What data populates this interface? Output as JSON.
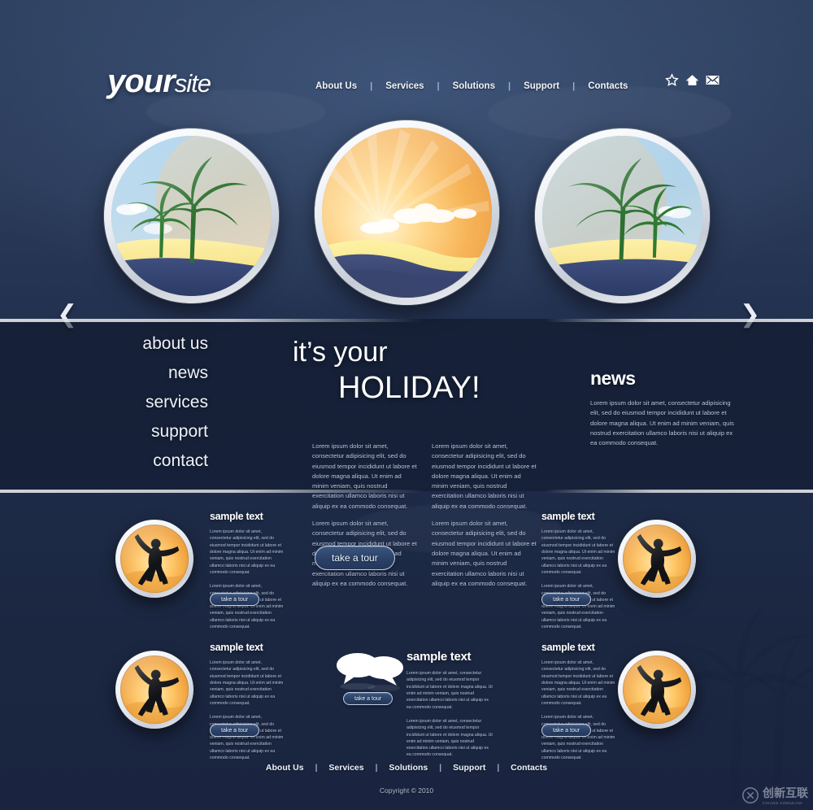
{
  "brand": {
    "part1": "your",
    "part2": "site"
  },
  "header": {
    "nav": [
      "About Us",
      "Services",
      "Solutions",
      "Support",
      "Contacts"
    ],
    "separator": "|",
    "icons": [
      "star-icon",
      "home-icon",
      "mail-icon"
    ]
  },
  "carousel": {
    "prev_label": "❮",
    "next_label": "❯",
    "slides": [
      {
        "name": "palm-beach-left",
        "caption": ""
      },
      {
        "name": "sunset-center",
        "caption": ""
      },
      {
        "name": "palm-beach-right",
        "caption": ""
      }
    ]
  },
  "sidemenu": {
    "items": [
      "about us",
      "news",
      "services",
      "support",
      "contact"
    ]
  },
  "hero": {
    "line1": "it’s your",
    "line2": "HOLIDAY!",
    "button": "take a tour",
    "columns": [
      {
        "paragraphs": [
          "Lorem ipsum dolor sit amet, consectetur adipisicing elit, sed do eiusmod tempor incididunt ut labore et dolore magna aliqua. Ut enim ad minim veniam, quis nostrud exercitation ullamco laboris nisi ut aliquip ex ea commodo consequat.",
          "Lorem ipsum dolor sit amet, consectetur adipisicing elit, sed do eiusmod tempor incididunt ut labore et dolore magna aliqua. Ut enim ad minim veniam, quis nostrud exercitation ullamco laboris nisi ut aliquip ex ea commodo consequat."
        ]
      },
      {
        "paragraphs": [
          "Lorem ipsum dolor sit amet, consectetur adipisicing elit, sed do eiusmod tempor incididunt ut labore et dolore magna aliqua. Ut enim ad minim veniam, quis nostrud exercitation ullamco laboris nisi ut aliquip ex ea commodo consequat.",
          "Lorem ipsum dolor sit amet, consectetur adipisicing elit, sed do eiusmod tempor incididunt ut labore et dolore magna aliqua. Ut enim ad minim veniam, quis nostrud exercitation ullamco laboris nisi ut aliquip ex ea commodo consequat."
        ]
      }
    ]
  },
  "news": {
    "title": "news",
    "body": "Lorem ipsum dolor sit amet, consectetur adipisicing elit, sed do eiusmod tempor incididunt ut labore et dolore magna aliqua. Ut enim ad minim veniam, quis nostrud exercitation ullamco laboris nisi ut aliquip ex ea commodo consequat."
  },
  "features": {
    "button": "take a tour",
    "lorem": "Lorem ipsum dolor sit amet, consectetur adipisicing elit, sed do eiusmod tempor incididunt ut labore et dolore magna aliqua. Ut enim ad minim veniam, quis nostrud exercitation ullamco laboris nisi ut aliquip ex ea commodo consequat.",
    "items": [
      {
        "title": "sample text",
        "icon": "jumping-person-badge"
      },
      {
        "title": "sample text",
        "icon": "jumping-person-badge"
      },
      {
        "title": "sample text",
        "icon": "jumping-person-badge"
      },
      {
        "title": "sample text",
        "icon": "speech-bubbles"
      },
      {
        "title": "sample text",
        "icon": "jumping-person-badge"
      }
    ]
  },
  "footer": {
    "nav": [
      "About Us",
      "Services",
      "Solutions",
      "Support",
      "Contacts"
    ],
    "separator": "|",
    "copyright": "Copyright © 2010"
  },
  "watermark": {
    "text": "创新互联",
    "sub": "CXIANG XINHULIAN"
  },
  "colors": {
    "bg_top": "#2d3f5e",
    "bg_bottom": "#1a2440",
    "text": "#ffffff",
    "muted": "#b9c6dc",
    "accent": "#f0a23c"
  }
}
